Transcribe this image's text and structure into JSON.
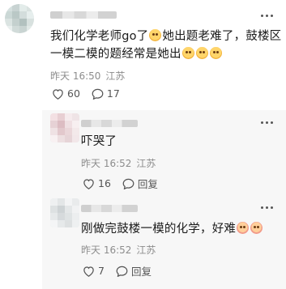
{
  "main_comment": {
    "text_line1": "我们化学老师go了",
    "text_line1b": "她出题老难了，鼓楼区",
    "text_line2": "一模二模的题经常是她出",
    "time": "昨天 16:50",
    "location": "江苏",
    "likes": "60",
    "replies": "17"
  },
  "reply1": {
    "text": "吓哭了",
    "time": "昨天 16:52",
    "location": "江苏",
    "likes": "16",
    "reply_label": "回复"
  },
  "reply2": {
    "text": "刚做完鼓楼一模的化学，好难",
    "time": "昨天 16:52",
    "location": "江苏",
    "likes": "7",
    "reply_label": "回复"
  },
  "colors": {
    "text": "#1b1b1b",
    "meta": "#8d8d8d",
    "reply_bg": "#f7f7f7"
  },
  "icons": [
    "more-dots-icon",
    "heart-icon",
    "comment-icon"
  ]
}
